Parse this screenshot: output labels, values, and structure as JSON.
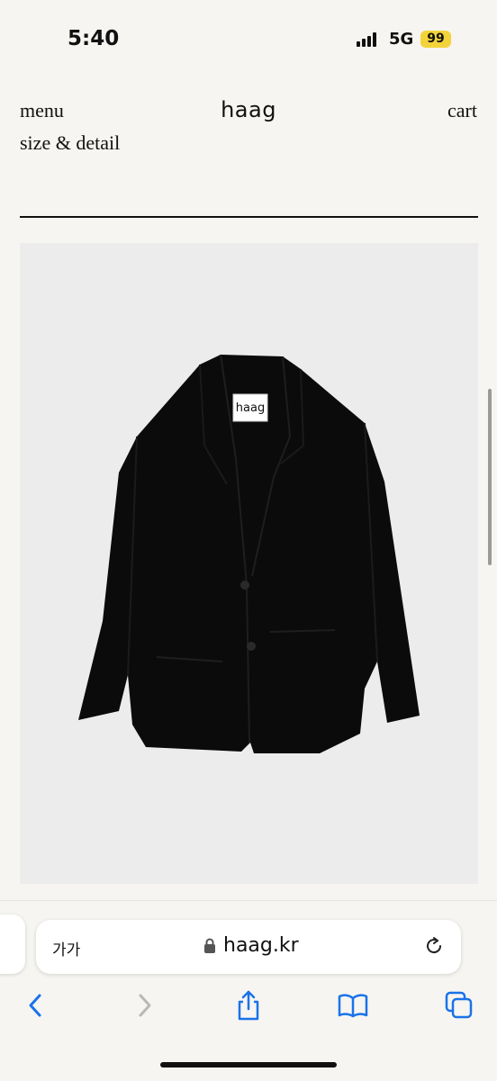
{
  "status_bar": {
    "time": "5:40",
    "network": "5G",
    "battery": "99"
  },
  "header": {
    "menu_label": "menu",
    "logo": "haag",
    "cart_label": "cart"
  },
  "section": {
    "title": "size & detail"
  },
  "product": {
    "tag_text": "haag"
  },
  "browser": {
    "aa_label": "가가",
    "domain": "haag.kr"
  },
  "icons": {
    "back": "chevron-left-icon",
    "forward": "chevron-right-icon",
    "share": "share-icon",
    "bookmarks": "book-icon",
    "tabs": "tabs-icon",
    "reload": "reload-icon",
    "lock": "lock-icon"
  },
  "colors": {
    "accent": "#1a73e8",
    "battery": "#f3d33a",
    "background": "#f6f5f1",
    "image_bg": "#ececec"
  }
}
